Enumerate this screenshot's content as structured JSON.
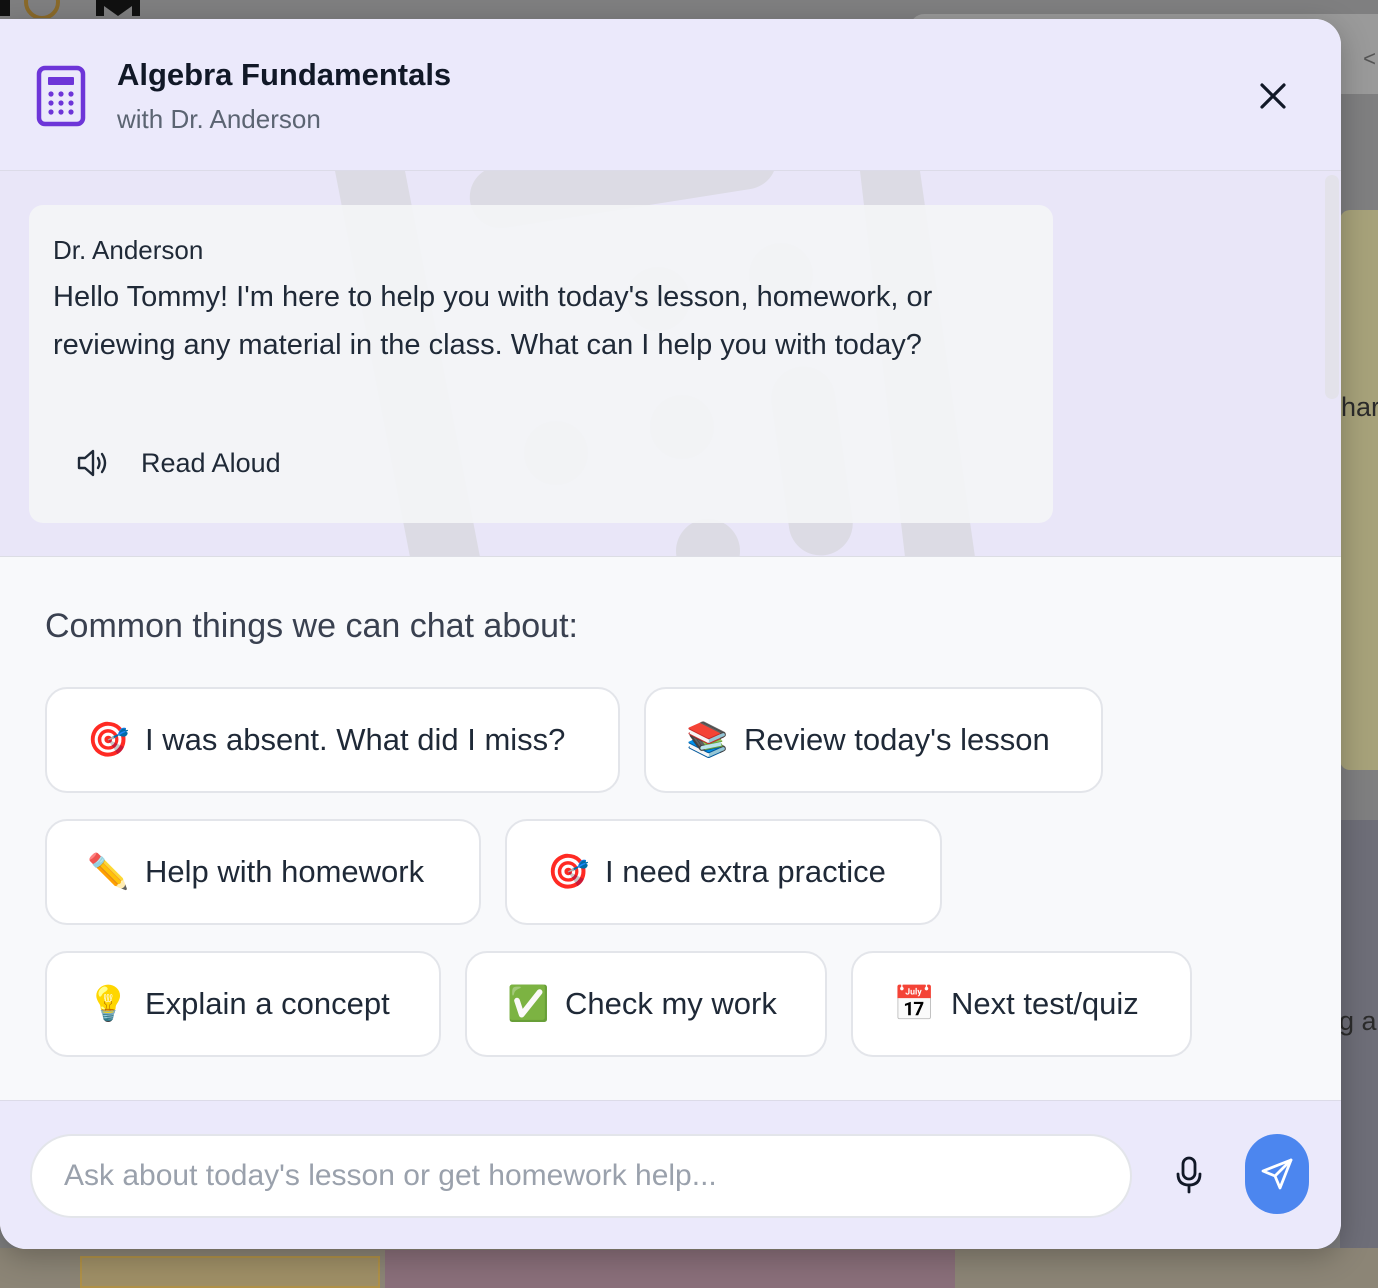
{
  "background": {
    "right_snippet_1": "har",
    "right_snippet_2": "g a",
    "top_chevron": "<"
  },
  "header": {
    "icon": "calculator-icon",
    "title": "Algebra Fundamentals",
    "subtitle": "with Dr. Anderson",
    "close_icon": "close-icon"
  },
  "chat": {
    "messages": [
      {
        "sender": "Dr. Anderson",
        "text": "Hello Tommy! I'm here to help you with today's lesson, homework, or reviewing any material in the class. What can I help you with today?",
        "read_aloud_icon": "speaker-icon",
        "read_aloud_label": "Read Aloud"
      }
    ]
  },
  "suggestions": {
    "title": "Common things we can chat about:",
    "items": [
      {
        "emoji": "🎯",
        "label": "I was absent. What did I miss?"
      },
      {
        "emoji": "📚",
        "label": "Review today's lesson"
      },
      {
        "emoji": "✏️",
        "label": "Help with homework"
      },
      {
        "emoji": "🎯",
        "label": "I need extra practice"
      },
      {
        "emoji": "💡",
        "label": "Explain a concept"
      },
      {
        "emoji": "✅",
        "label": "Check my work"
      },
      {
        "emoji": "📅",
        "label": "Next test/quiz"
      }
    ]
  },
  "input": {
    "placeholder": "Ask about today's lesson or get homework help...",
    "value": "",
    "mic_icon": "microphone-icon",
    "send_icon": "send-icon"
  },
  "colors": {
    "header_bg": "#ebe9fb",
    "accent_purple": "#6d35d8",
    "send_button": "#4c86ef"
  }
}
